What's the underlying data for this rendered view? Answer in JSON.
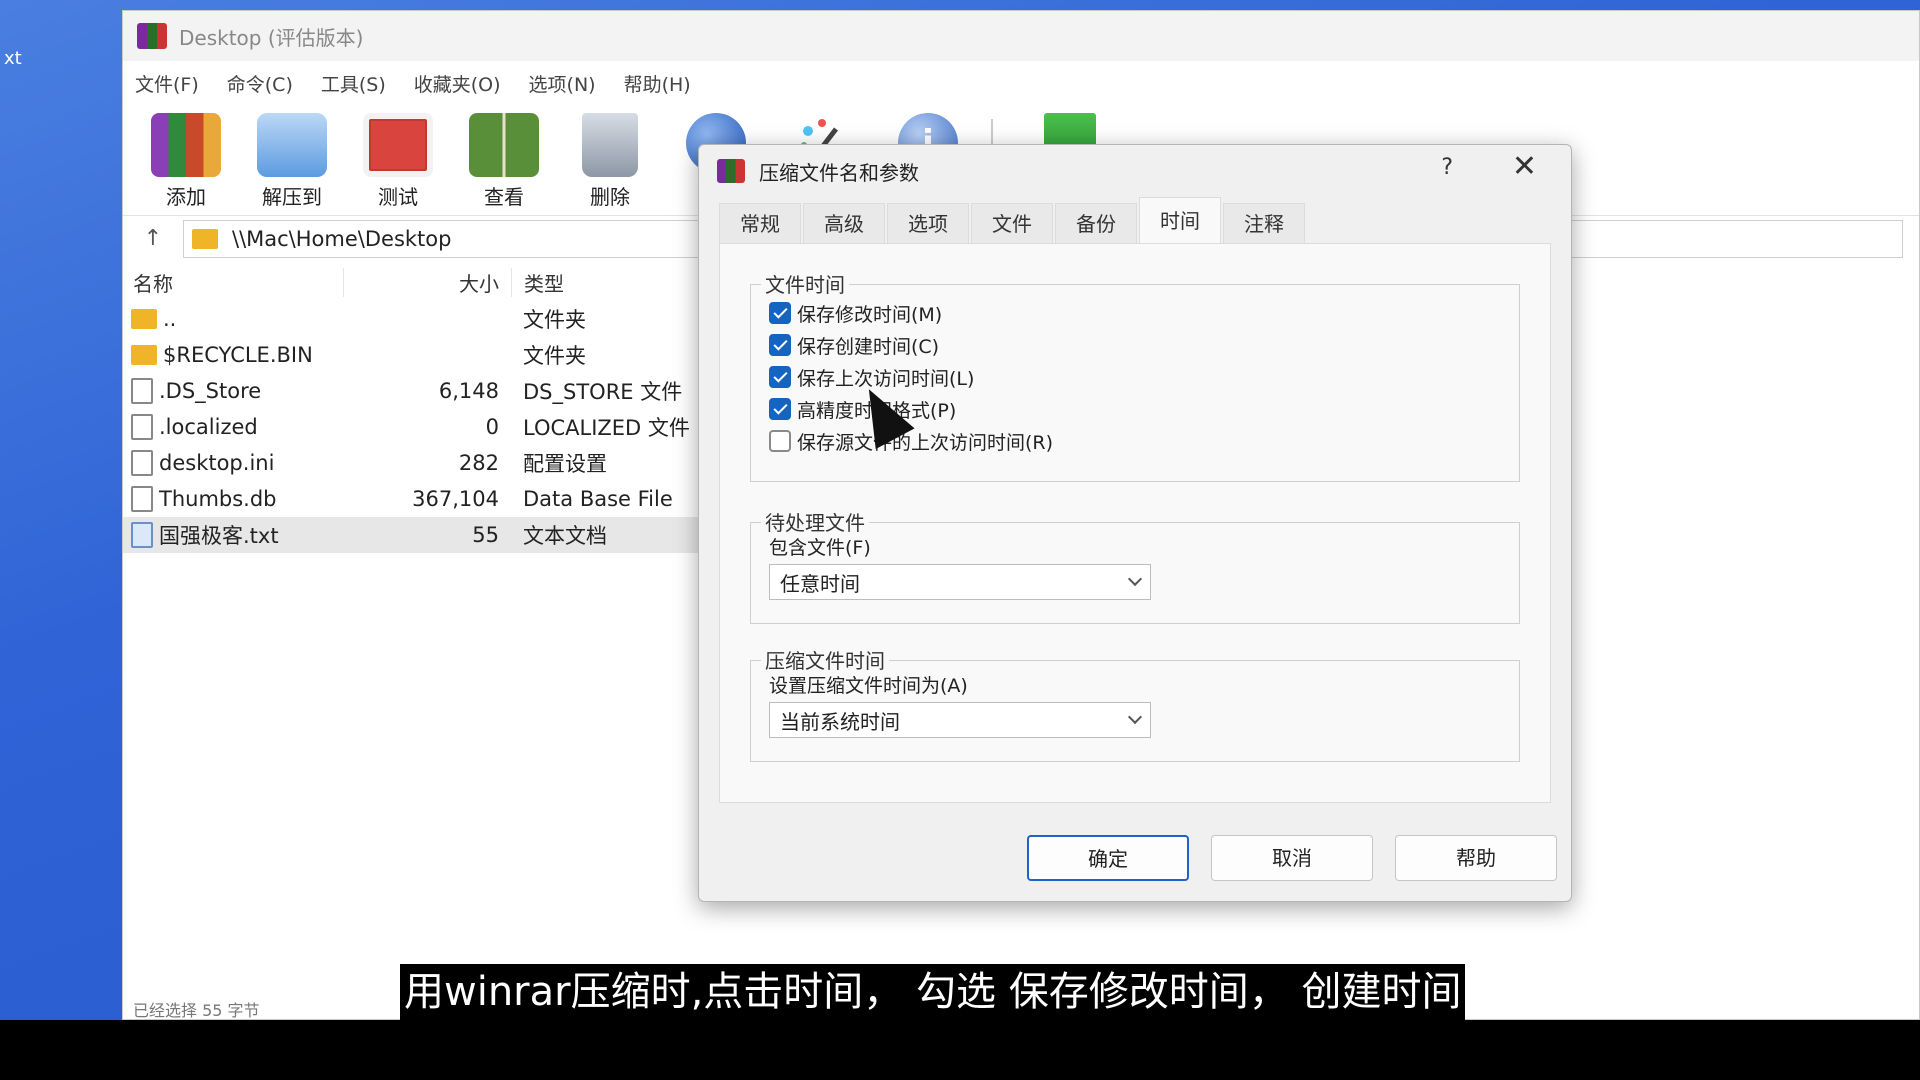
{
  "desktop": {
    "edge_text": "xt"
  },
  "window": {
    "title": "Desktop (评估版本)",
    "menu": [
      "文件(F)",
      "命令(C)",
      "工具(S)",
      "收藏夹(O)",
      "选项(N)",
      "帮助(H)"
    ],
    "toolbar": [
      {
        "label": "添加",
        "icon": "add-archive-icon"
      },
      {
        "label": "解压到",
        "icon": "extract-to-icon"
      },
      {
        "label": "测试",
        "icon": "test-icon"
      },
      {
        "label": "查看",
        "icon": "view-book-icon"
      },
      {
        "label": "删除",
        "icon": "trash-icon"
      }
    ],
    "path": "\\\\Mac\\Home\\Desktop",
    "columns": {
      "name": "名称",
      "size": "大小",
      "type": "类型"
    },
    "files": [
      {
        "name": "..",
        "size": "",
        "type": "文件夹",
        "icon": "folder-icon"
      },
      {
        "name": "$RECYCLE.BIN",
        "size": "",
        "type": "文件夹",
        "icon": "folder-icon"
      },
      {
        "name": ".DS_Store",
        "size": "6,148",
        "type": "DS_STORE 文件",
        "icon": "file-icon"
      },
      {
        "name": ".localized",
        "size": "0",
        "type": "LOCALIZED 文件",
        "icon": "file-icon"
      },
      {
        "name": "desktop.ini",
        "size": "282",
        "type": "配置设置",
        "icon": "settings-file-icon"
      },
      {
        "name": "Thumbs.db",
        "size": "367,104",
        "type": "Data Base File",
        "icon": "db-file-icon"
      },
      {
        "name": "国强极客.txt",
        "size": "55",
        "type": "文本文档",
        "icon": "text-file-icon"
      }
    ],
    "status_text": "已经选择 55 字节"
  },
  "dialog": {
    "title": "压缩文件名和参数",
    "help_glyph": "?",
    "close_glyph": "✕",
    "tabs": [
      "常规",
      "高级",
      "选项",
      "文件",
      "备份",
      "时间",
      "注释"
    ],
    "active_tab": "时间",
    "file_time": {
      "title": "文件时间",
      "options": [
        {
          "label": "保存修改时间(M)",
          "checked": true
        },
        {
          "label": "保存创建时间(C)",
          "checked": true
        },
        {
          "label": "保存上次访问时间(L)",
          "checked": true
        },
        {
          "label": "高精度时间格式(P)",
          "checked": true
        },
        {
          "label": "保存源文件的上次访问时间(R)",
          "checked": false
        }
      ]
    },
    "pending_files": {
      "title": "待处理文件",
      "field_label": "包含文件(F)",
      "value": "任意时间"
    },
    "archive_time": {
      "title": "压缩文件时间",
      "field_label": "设置压缩文件时间为(A)",
      "value": "当前系统时间"
    },
    "buttons": {
      "ok": "确定",
      "cancel": "取消",
      "help": "帮助"
    }
  },
  "caption": "用winrar压缩时,点击时间， 勾选 保存修改时间， 创建时间"
}
